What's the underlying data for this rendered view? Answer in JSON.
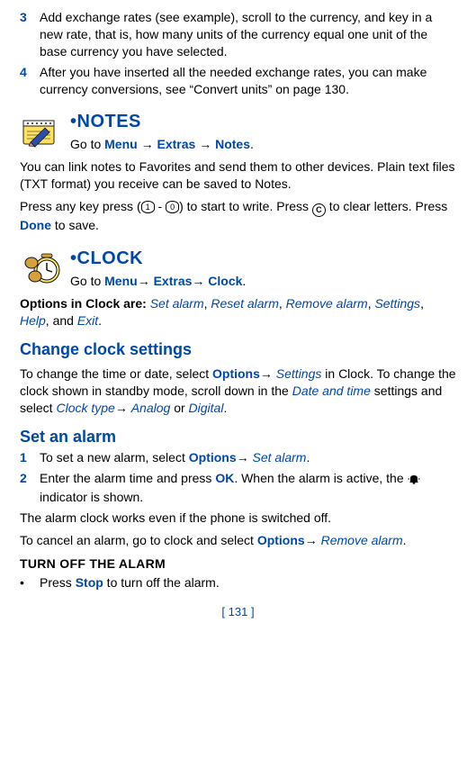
{
  "steps_top": [
    {
      "n": "3",
      "text_a": "Add exchange rates (see example), scroll to the currency, and key in a new rate, that is, how many units of the currency equal one unit of the base currency you have selected."
    },
    {
      "n": "4",
      "text_a": "After you have inserted all the needed exchange rates, you can make currency conversions, see “Convert units” on page 130."
    }
  ],
  "notes": {
    "title": "•NOTES",
    "goto_prefix": "Go to ",
    "menu": "Menu",
    "arrow": "→",
    "extras": "Extras",
    "notes": "Notes",
    "period": ".",
    "para1": "You can link notes to Favorites and send them to other devices. Plain text files (TXT format) you receive can be saved to Notes.",
    "press_a": "Press any key press (",
    "key1": "1",
    "dash": " - ",
    "key0": "0",
    "press_b": ") to start to write. Press ",
    "c": "C",
    "press_c": " to clear letters. Press ",
    "done": "Done",
    "press_d": " to save."
  },
  "clock": {
    "title": "•CLOCK",
    "goto_prefix": "Go to ",
    "menu": "Menu",
    "arrow": "→",
    "extras": "Extras",
    "clock": "Clock",
    "period": ".",
    "opts_lead": "Options in Clock are: ",
    "o1": "Set alarm",
    "c1": ", ",
    "o2": "Reset alarm",
    "c2": ", ",
    "o3": "Remove alarm",
    "c3": ", ",
    "o4": "Settings",
    "c4": ", ",
    "o5": "Help",
    "c5": ", and ",
    "o6": "Exit",
    "c6": "."
  },
  "change": {
    "head": "Change clock settings",
    "a": "To change the time or date, select ",
    "options": "Options",
    "arrow": "→",
    "settings": " Settings",
    "b": " in Clock. To change the clock shown in standby mode, scroll down in the ",
    "dat": "Date and time",
    "c": " settings and select ",
    "ctype": "Clock type",
    "d": " ",
    "analog": "Analog",
    "or": " or ",
    "digital": "Digital",
    "e": "."
  },
  "setalarm": {
    "head": "Set an alarm",
    "s1_n": "1",
    "s1_a": "To set a new alarm, select ",
    "s1_opt": "Options",
    "s1_arr": "→",
    "s1_sa": " Set alarm",
    "s1_b": ".",
    "s2_n": "2",
    "s2_a": "Enter the alarm time and press ",
    "s2_ok": "OK",
    "s2_b": ". When the alarm is active, the ",
    "s2_c": " indicator is shown.",
    "p1": "The alarm clock works even if the phone is switched off.",
    "p2a": "To cancel an alarm, go to clock and select ",
    "p2opt": "Options",
    "p2arr": "→",
    "p2ra": " Remove alarm",
    "p2b": "."
  },
  "turnoff": {
    "head": "TURN OFF THE ALARM",
    "bullet": "•",
    "a": "Press ",
    "stop": "Stop",
    "b": " to turn off the alarm."
  },
  "footer": "[ 131 ]"
}
